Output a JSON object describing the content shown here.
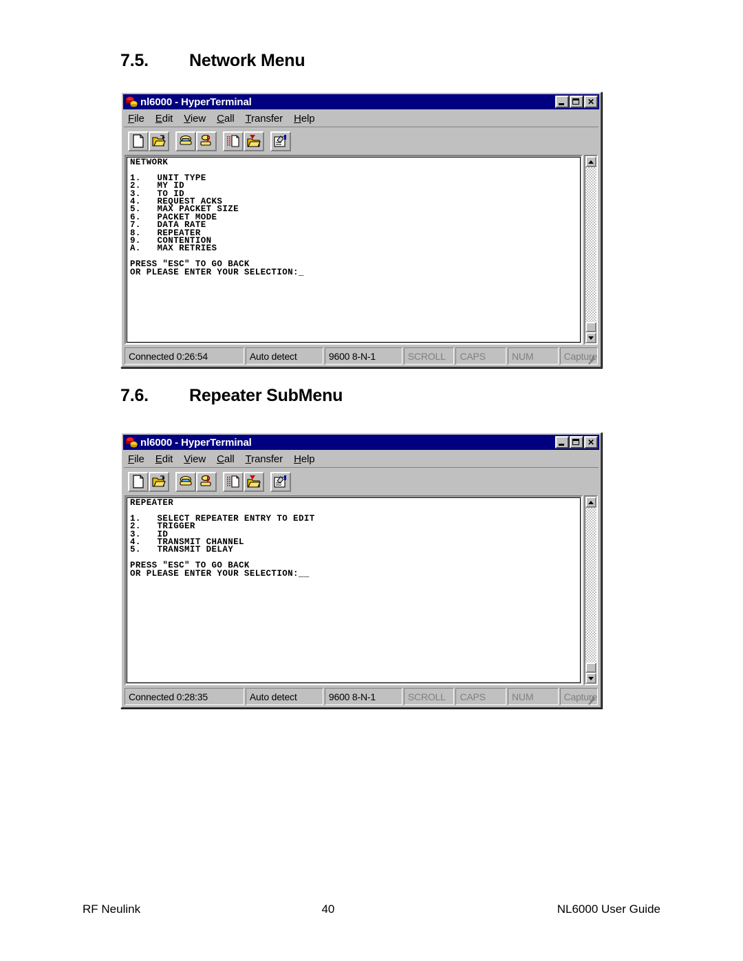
{
  "sections": [
    {
      "number": "7.5.",
      "title": "Network Menu"
    },
    {
      "number": "7.6.",
      "title": "Repeater SubMenu"
    }
  ],
  "window": {
    "title": "nl6000 - HyperTerminal",
    "title_icon": "phone-modem-icon",
    "controls": {
      "minimize": "_",
      "maximize": "□",
      "close": "✕"
    },
    "menus": [
      {
        "accel": "F",
        "rest": "ile"
      },
      {
        "accel": "E",
        "rest": "dit"
      },
      {
        "accel": "V",
        "rest": "iew"
      },
      {
        "accel": "C",
        "rest": "all"
      },
      {
        "accel": "T",
        "rest": "ransfer"
      },
      {
        "accel": "H",
        "rest": "elp"
      }
    ],
    "toolbar": [
      {
        "name": "new-connection-icon",
        "tip": "New"
      },
      {
        "name": "open-file-icon",
        "tip": "Open"
      },
      {
        "name": "call-icon",
        "tip": "Call"
      },
      {
        "name": "disconnect-icon",
        "tip": "Disconnect"
      },
      {
        "name": "send-file-icon",
        "tip": "Send"
      },
      {
        "name": "receive-file-icon",
        "tip": "Receive"
      },
      {
        "name": "properties-icon",
        "tip": "Properties"
      }
    ]
  },
  "terminal_1": {
    "heading": "NETWORK",
    "content": "NETWORK\n\n1.   UNIT TYPE\n2.   MY ID\n3.   TO ID\n4.   REQUEST ACKS\n5.   MAX PACKET SIZE\n6.   PACKET MODE\n7.   DATA RATE\n8.   REPEATER\n9.   CONTENTION\nA.   MAX RETRIES\n\nPRESS \"ESC\" TO GO BACK\nOR PLEASE ENTER YOUR SELECTION:_",
    "menu_items": [
      {
        "key": "1.",
        "label": "UNIT TYPE"
      },
      {
        "key": "2.",
        "label": "MY ID"
      },
      {
        "key": "3.",
        "label": "TO ID"
      },
      {
        "key": "4.",
        "label": "REQUEST ACKS"
      },
      {
        "key": "5.",
        "label": "MAX PACKET SIZE"
      },
      {
        "key": "6.",
        "label": "PACKET MODE"
      },
      {
        "key": "7.",
        "label": "DATA RATE"
      },
      {
        "key": "8.",
        "label": "REPEATER"
      },
      {
        "key": "9.",
        "label": "CONTENTION"
      },
      {
        "key": "A.",
        "label": "MAX RETRIES"
      }
    ],
    "prompt_line_1": "PRESS \"ESC\" TO GO BACK",
    "prompt_line_2": "OR PLEASE ENTER YOUR SELECTION:_"
  },
  "terminal_2": {
    "heading": "REPEATER",
    "content": "REPEATER\n\n1.   SELECT REPEATER ENTRY TO EDIT\n2.   TRIGGER\n3.   ID\n4.   TRANSMIT CHANNEL\n5.   TRANSMIT DELAY\n\nPRESS \"ESC\" TO GO BACK\nOR PLEASE ENTER YOUR SELECTION:__",
    "menu_items": [
      {
        "key": "1.",
        "label": "SELECT REPEATER ENTRY TO EDIT"
      },
      {
        "key": "2.",
        "label": "TRIGGER"
      },
      {
        "key": "3.",
        "label": "ID"
      },
      {
        "key": "4.",
        "label": "TRANSMIT CHANNEL"
      },
      {
        "key": "5.",
        "label": "TRANSMIT DELAY"
      }
    ],
    "prompt_line_1": "PRESS \"ESC\" TO GO BACK",
    "prompt_line_2": "OR PLEASE ENTER YOUR SELECTION:__"
  },
  "status_1": {
    "connected": "Connected 0:26:54",
    "detect": "Auto detect",
    "rate": "9600 8-N-1",
    "scroll": "SCROLL",
    "caps": "CAPS",
    "num": "NUM",
    "capture": "Capture"
  },
  "status_2": {
    "connected": "Connected 0:28:35",
    "detect": "Auto detect",
    "rate": "9600 8-N-1",
    "scroll": "SCROLL",
    "caps": "CAPS",
    "num": "NUM",
    "capture": "Capture"
  },
  "footer": {
    "left": "RF Neulink",
    "center": "40",
    "right": "NL6000 User Guide"
  },
  "colors": {
    "titlebar": "#000080",
    "chrome": "#c0c0c0",
    "terminal_bg": "#ffffff",
    "terminal_fg": "#000000",
    "disabled_text": "#808080"
  }
}
